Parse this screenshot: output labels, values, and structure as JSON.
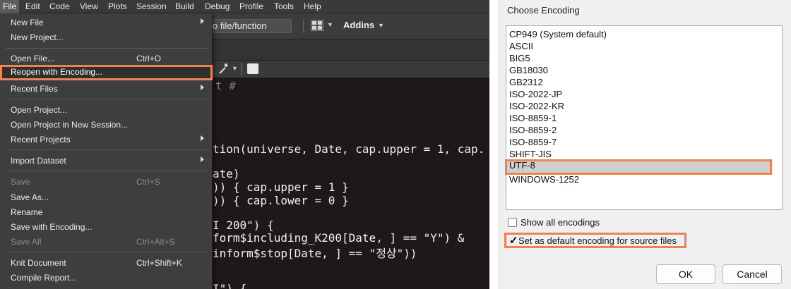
{
  "menubar": {
    "items": [
      "File",
      "Edit",
      "Code",
      "View",
      "Plots",
      "Session",
      "Build",
      "Debug",
      "Profile",
      "Tools",
      "Help"
    ]
  },
  "toolbar": {
    "goto_text": "o file/function",
    "addins_label": "Addins"
  },
  "code": {
    "lines": [
      "t #",
      "tion(universe, Date, cap.upper = 1, cap.",
      "ate)",
      ")) { cap.upper = 1 }",
      ")) { cap.lower = 0 }",
      "I 200\") {",
      "form$including_K200[Date, ] == \"Y\") &",
      "inform$stop[Date, ] == \"정상\"))",
      "I\") {"
    ]
  },
  "file_menu": {
    "items": [
      {
        "label": "New File",
        "shortcut": "",
        "submenu": true,
        "disabled": false
      },
      {
        "label": "New Project...",
        "shortcut": "",
        "submenu": false,
        "disabled": false
      },
      {
        "label": "Open File...",
        "shortcut": "Ctrl+O",
        "submenu": false,
        "disabled": false
      },
      {
        "label": "Reopen with Encoding...",
        "shortcut": "",
        "submenu": false,
        "disabled": false,
        "highlighted": true
      },
      {
        "label": "Recent Files",
        "shortcut": "",
        "submenu": true,
        "disabled": false
      },
      {
        "label": "Open Project...",
        "shortcut": "",
        "submenu": false,
        "disabled": false
      },
      {
        "label": "Open Project in New Session...",
        "shortcut": "",
        "submenu": false,
        "disabled": false
      },
      {
        "label": "Recent Projects",
        "shortcut": "",
        "submenu": true,
        "disabled": false
      },
      {
        "label": "Import Dataset",
        "shortcut": "",
        "submenu": true,
        "disabled": false
      },
      {
        "label": "Save",
        "shortcut": "Ctrl+S",
        "submenu": false,
        "disabled": true
      },
      {
        "label": "Save As...",
        "shortcut": "",
        "submenu": false,
        "disabled": false
      },
      {
        "label": "Rename",
        "shortcut": "",
        "submenu": false,
        "disabled": false
      },
      {
        "label": "Save with Encoding...",
        "shortcut": "",
        "submenu": false,
        "disabled": false
      },
      {
        "label": "Save All",
        "shortcut": "Ctrl+Alt+S",
        "submenu": false,
        "disabled": true
      },
      {
        "label": "Knit Document",
        "shortcut": "Ctrl+Shift+K",
        "submenu": false,
        "disabled": false
      },
      {
        "label": "Compile Report...",
        "shortcut": "",
        "submenu": false,
        "disabled": false
      }
    ]
  },
  "dialog": {
    "title": "Choose Encoding",
    "encodings": [
      "CP949 (System default)",
      "ASCII",
      "BIG5",
      "GB18030",
      "GB2312",
      "ISO-2022-JP",
      "ISO-2022-KR",
      "ISO-8859-1",
      "ISO-8859-2",
      "ISO-8859-7",
      "SHIFT-JIS",
      "UTF-8",
      "WINDOWS-1252"
    ],
    "selected_encoding": "UTF-8",
    "show_all_label": "Show all encodings",
    "show_all_checked": false,
    "set_default_label": "Set as default encoding for source files",
    "set_default_checked": true,
    "ok_label": "OK",
    "cancel_label": "Cancel"
  },
  "colors": {
    "highlight_outline": "#ee8250",
    "menu_bg": "#3e3e3e",
    "code_bg": "#1e1818",
    "dialog_bg": "#f0f0f0",
    "selected_row_bg": "#cfcfcf"
  },
  "icons": [
    "grid-icon",
    "wand-icon",
    "document-icon",
    "chevron-down-icon",
    "submenu-arrow-icon",
    "checkmark-icon"
  ]
}
